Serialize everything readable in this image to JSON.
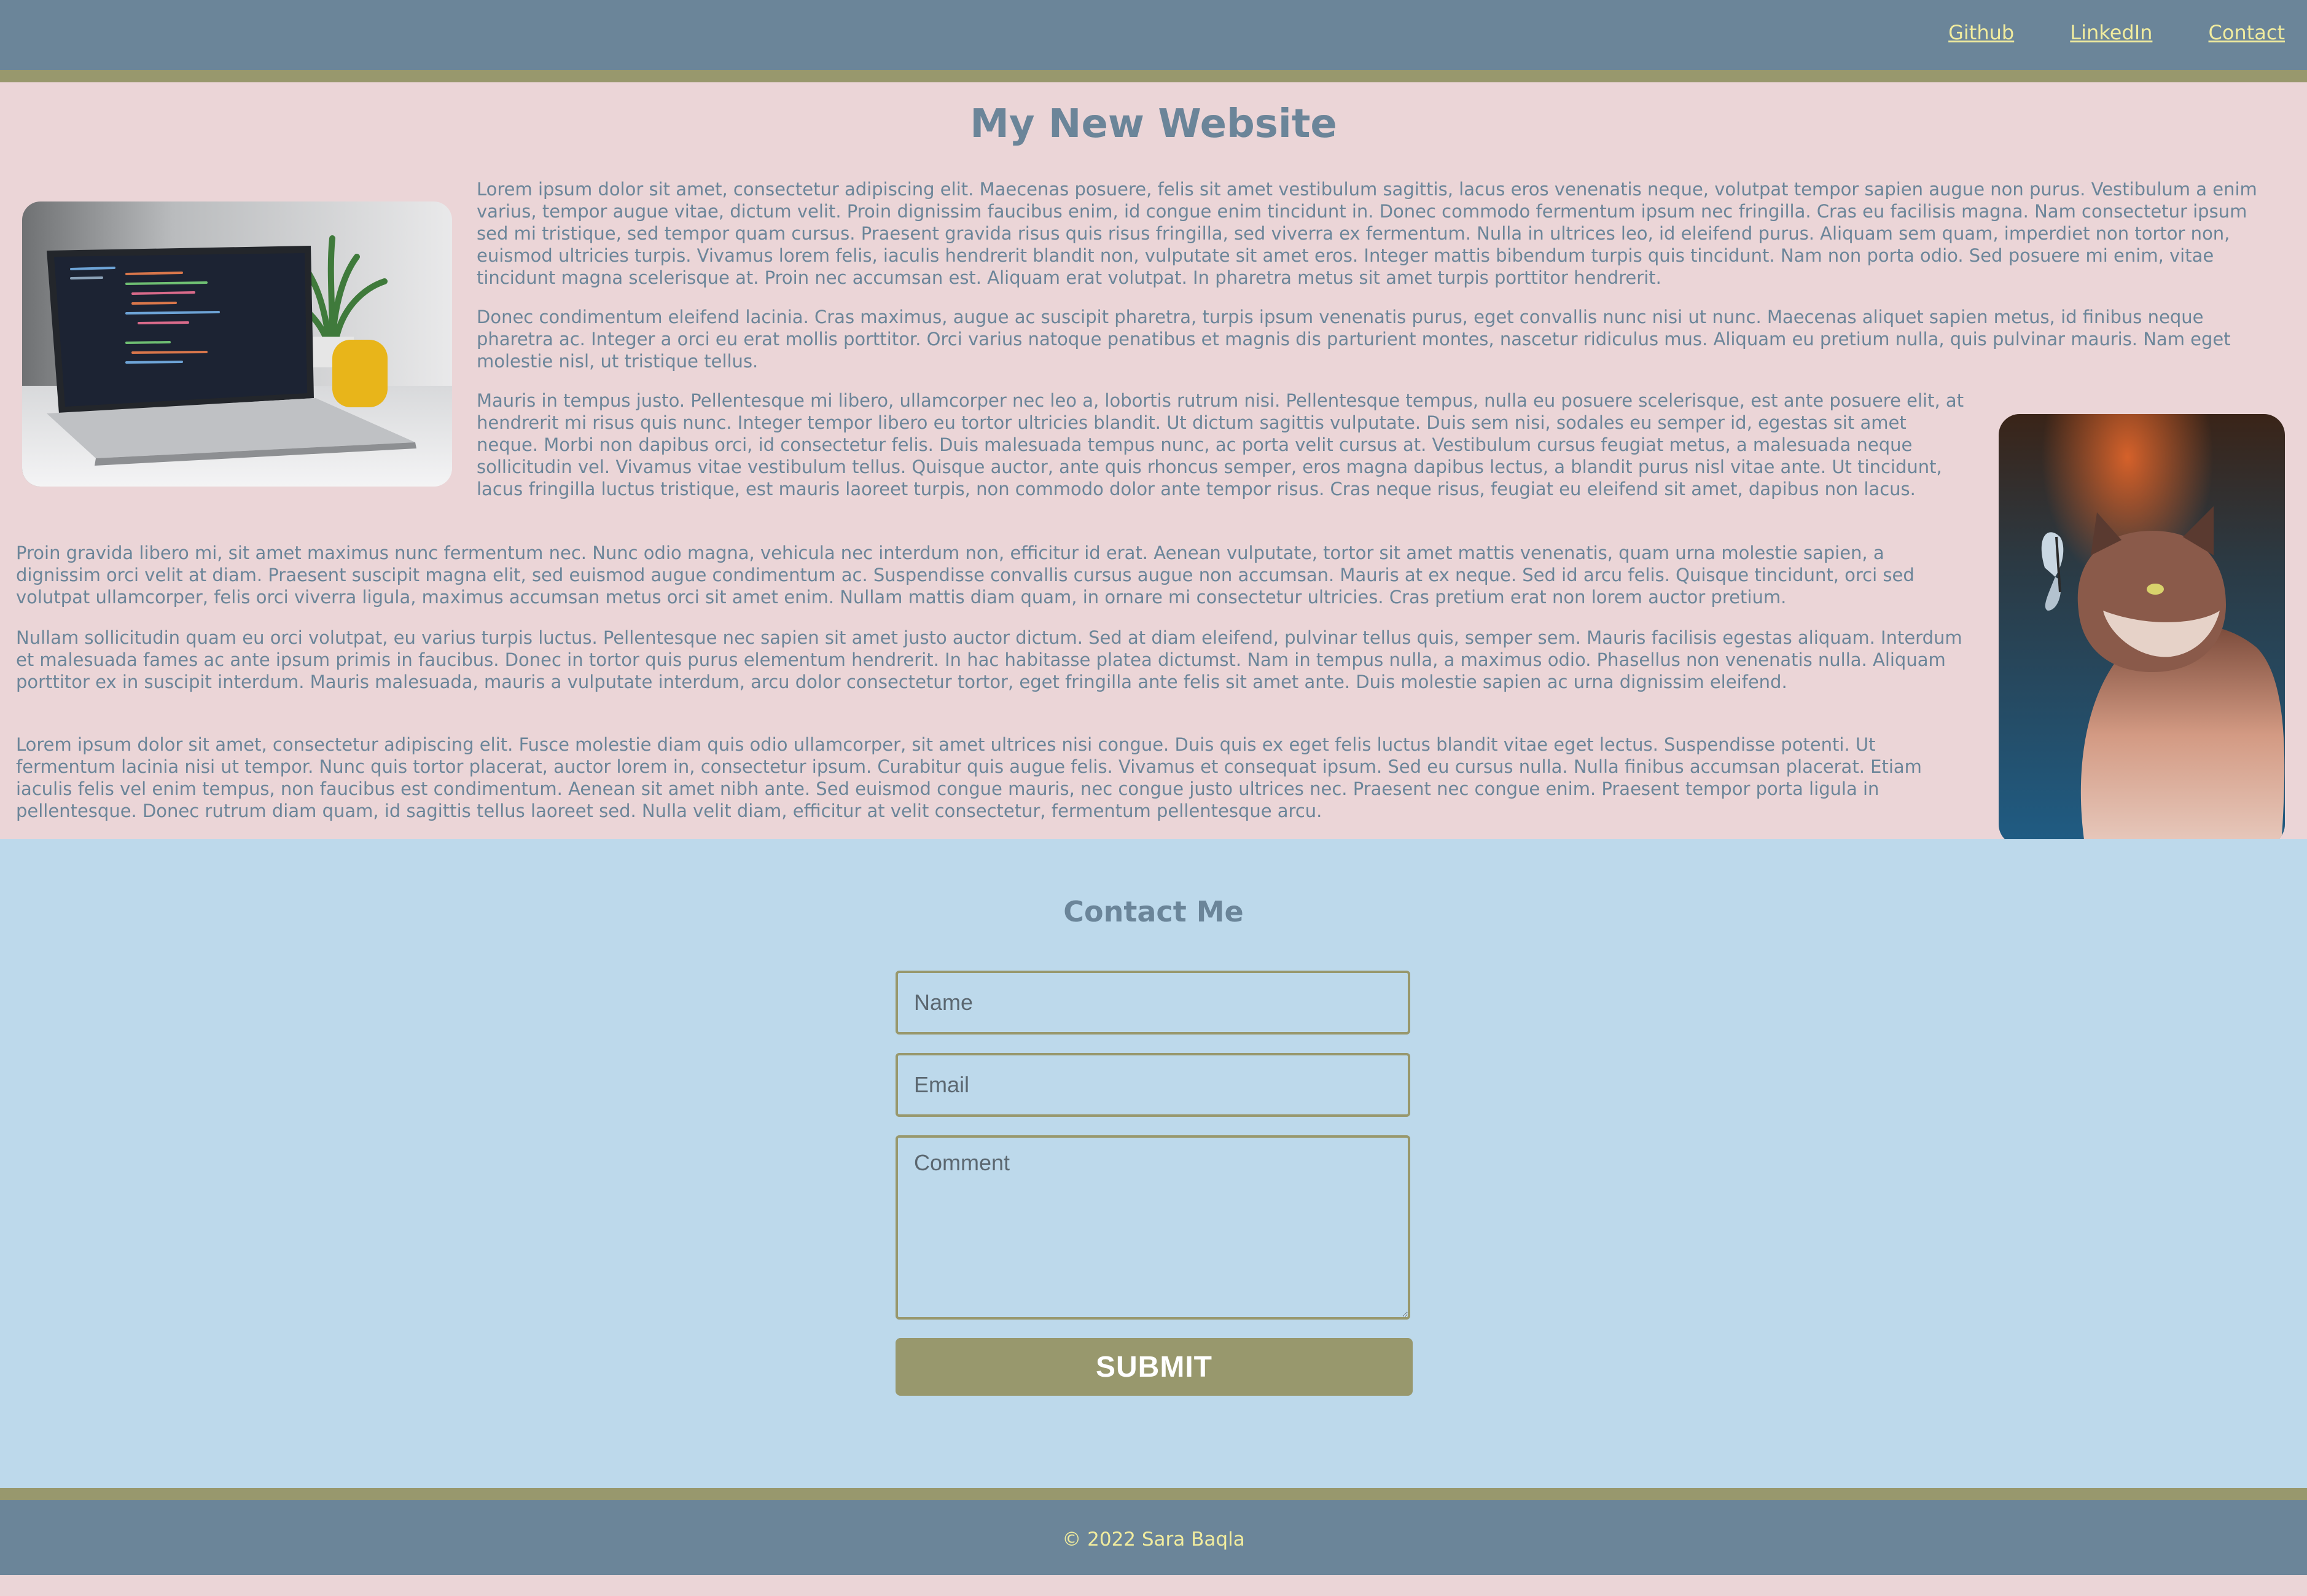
{
  "nav": {
    "links": [
      "Github",
      "LinkedIn",
      "Contact"
    ]
  },
  "main": {
    "title": "My New Website",
    "images": {
      "laptop": "laptop-with-code-and-plant-photo",
      "cat": "cat-with-butterfly-photo"
    },
    "paragraphs": [
      "Lorem ipsum dolor sit amet, consectetur adipiscing elit. Maecenas posuere, felis sit amet vestibulum sagittis, lacus eros venenatis neque, volutpat tempor sapien augue non purus. Vestibulum a enim varius, tempor augue vitae, dictum velit. Proin dignissim faucibus enim, id congue enim tincidunt in. Donec commodo fermentum ipsum nec fringilla. Cras eu facilisis magna. Nam consectetur ipsum sed mi tristique, sed tempor quam cursus. Praesent gravida risus quis risus fringilla, sed viverra ex fermentum. Nulla in ultrices leo, id eleifend purus. Aliquam sem quam, imperdiet non tortor non, euismod ultricies turpis. Vivamus lorem felis, iaculis hendrerit blandit non, vulputate sit amet eros. Integer mattis bibendum turpis quis tincidunt. Nam non porta odio. Sed posuere mi enim, vitae tincidunt magna scelerisque at. Proin nec accumsan est. Aliquam erat volutpat. In pharetra metus sit amet turpis porttitor hendrerit.",
      "Donec condimentum eleifend lacinia. Cras maximus, augue ac suscipit pharetra, turpis ipsum venenatis purus, eget convallis nunc nisi ut nunc. Maecenas aliquet sapien metus, id finibus neque pharetra ac. Integer a orci eu erat mollis porttitor. Orci varius natoque penatibus et magnis dis parturient montes, nascetur ridiculus mus. Aliquam eu pretium nulla, quis pulvinar mauris. Nam eget molestie nisl, ut tristique tellus.",
      "Mauris in tempus justo. Pellentesque mi libero, ullamcorper nec leo a, lobortis rutrum nisi. Pellentesque tempus, nulla eu posuere scelerisque, est ante posuere elit, at hendrerit mi risus quis nunc. Integer tempor libero eu tortor ultricies blandit. Ut dictum sagittis vulputate. Duis sem nisi, sodales eu semper id, egestas sit amet neque. Morbi non dapibus orci, id consectetur felis. Duis malesuada tempus nunc, ac porta velit cursus at. Vestibulum cursus feugiat metus, a malesuada neque sollicitudin vel. Vivamus vitae vestibulum tellus. Quisque auctor, ante quis rhoncus semper, eros magna dapibus lectus, a blandit purus nisl vitae ante. Ut tincidunt, lacus fringilla luctus tristique, est mauris laoreet turpis, non commodo dolor ante tempor risus. Cras neque risus, feugiat eu eleifend sit amet, dapibus non lacus.",
      "Proin gravida libero mi, sit amet maximus nunc fermentum nec. Nunc odio magna, vehicula nec interdum non, efficitur id erat. Aenean vulputate, tortor sit amet mattis venenatis, quam urna molestie sapien, a dignissim orci velit at diam. Praesent suscipit magna elit, sed euismod augue condimentum ac. Suspendisse convallis cursus augue non accumsan. Mauris at ex neque. Sed id arcu felis. Quisque tincidunt, orci sed volutpat ullamcorper, felis orci viverra ligula, maximus accumsan metus orci sit amet enim. Nullam mattis diam quam, in ornare mi consectetur ultricies. Cras pretium erat non lorem auctor pretium.",
      "Nullam sollicitudin quam eu orci volutpat, eu varius turpis luctus. Pellentesque nec sapien sit amet justo auctor dictum. Sed at diam eleifend, pulvinar tellus quis, semper sem. Mauris facilisis egestas aliquam. Interdum et malesuada fames ac ante ipsum primis in faucibus. Donec in tortor quis purus elementum hendrerit. In hac habitasse platea dictumst. Nam in tempus nulla, a maximus odio. Phasellus non venenatis nulla. Aliquam porttitor ex in suscipit interdum. Mauris malesuada, mauris a vulputate interdum, arcu dolor consectetur tortor, eget fringilla ante felis sit amet ante. Duis molestie sapien ac urna dignissim eleifend.",
      "Lorem ipsum dolor sit amet, consectetur adipiscing elit. Fusce molestie diam quis odio ullamcorper, sit amet ultrices nisi congue. Duis quis ex eget felis luctus blandit vitae eget lectus. Suspendisse potenti. Ut fermentum lacinia nisi ut tempor. Nunc quis tortor placerat, auctor lorem in, consectetur ipsum. Curabitur quis augue felis. Vivamus et consequat ipsum. Sed eu cursus nulla. Nulla finibus accumsan placerat. Etiam iaculis felis vel enim tempus, non faucibus est condimentum. Aenean sit amet nibh ante. Sed euismod congue mauris, nec congue justo ultrices nec. Praesent nec congue enim. Praesent tempor porta ligula in pellentesque. Donec rutrum diam quam, id sagittis tellus laoreet sed. Nulla velit diam, efficitur at velit consectetur, fermentum pellentesque arcu."
    ]
  },
  "contact": {
    "title": "Contact Me",
    "name_placeholder": "Name",
    "email_placeholder": "Email",
    "comment_placeholder": "Comment",
    "submit_label": "SUBMIT"
  },
  "footer": {
    "copyright": "© 2022 Sara Baqla"
  },
  "colors": {
    "nav_bg": "#6b8599",
    "accent_stripe": "#98986d",
    "link": "#f1ec9e",
    "main_bg": "#ebd5d7",
    "contact_bg": "#bdd9eb",
    "text": "#6b8599"
  }
}
